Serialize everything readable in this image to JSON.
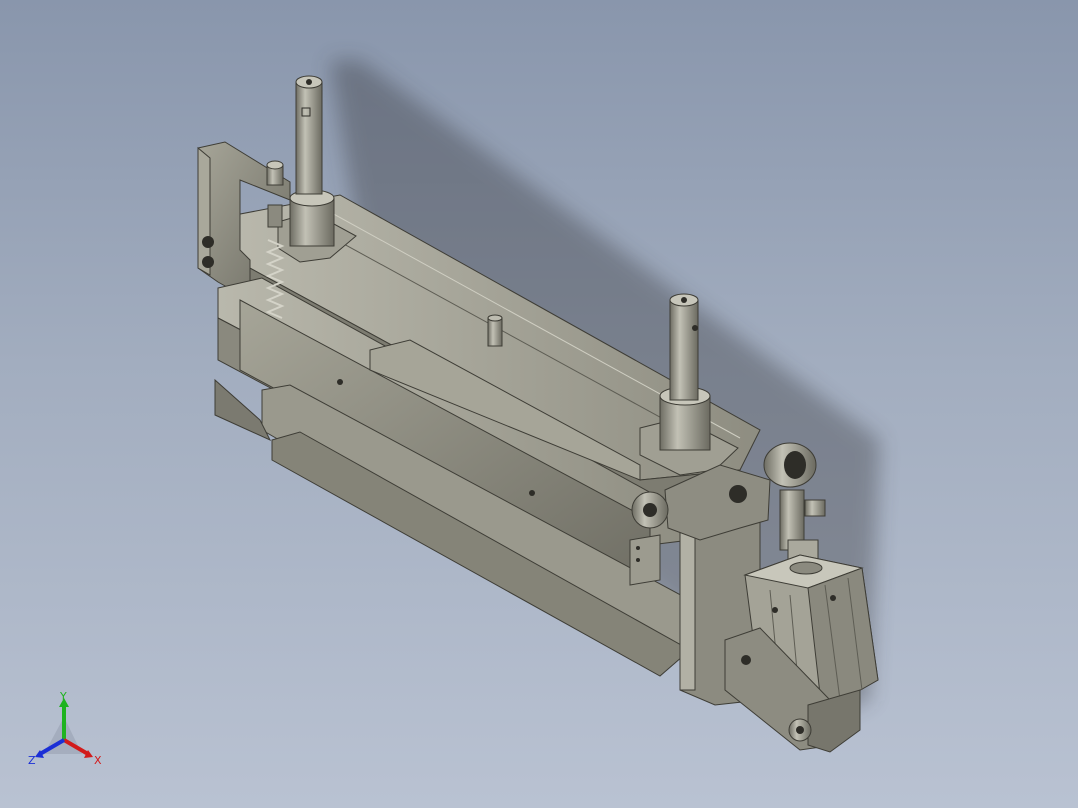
{
  "viewport": {
    "background_top": "#8996ac",
    "background_bottom": "#b9c2d2"
  },
  "model": {
    "part_color": "#8f8e82",
    "part_light": "#b3b2a6",
    "part_dark": "#5f5e55",
    "cylinder_color": "#9a998d"
  },
  "triad": {
    "x_label": "X",
    "y_label": "Y",
    "z_label": "Z",
    "x_color": "#d21b1b",
    "y_color": "#1fb31f",
    "z_color": "#1b2fd6"
  }
}
